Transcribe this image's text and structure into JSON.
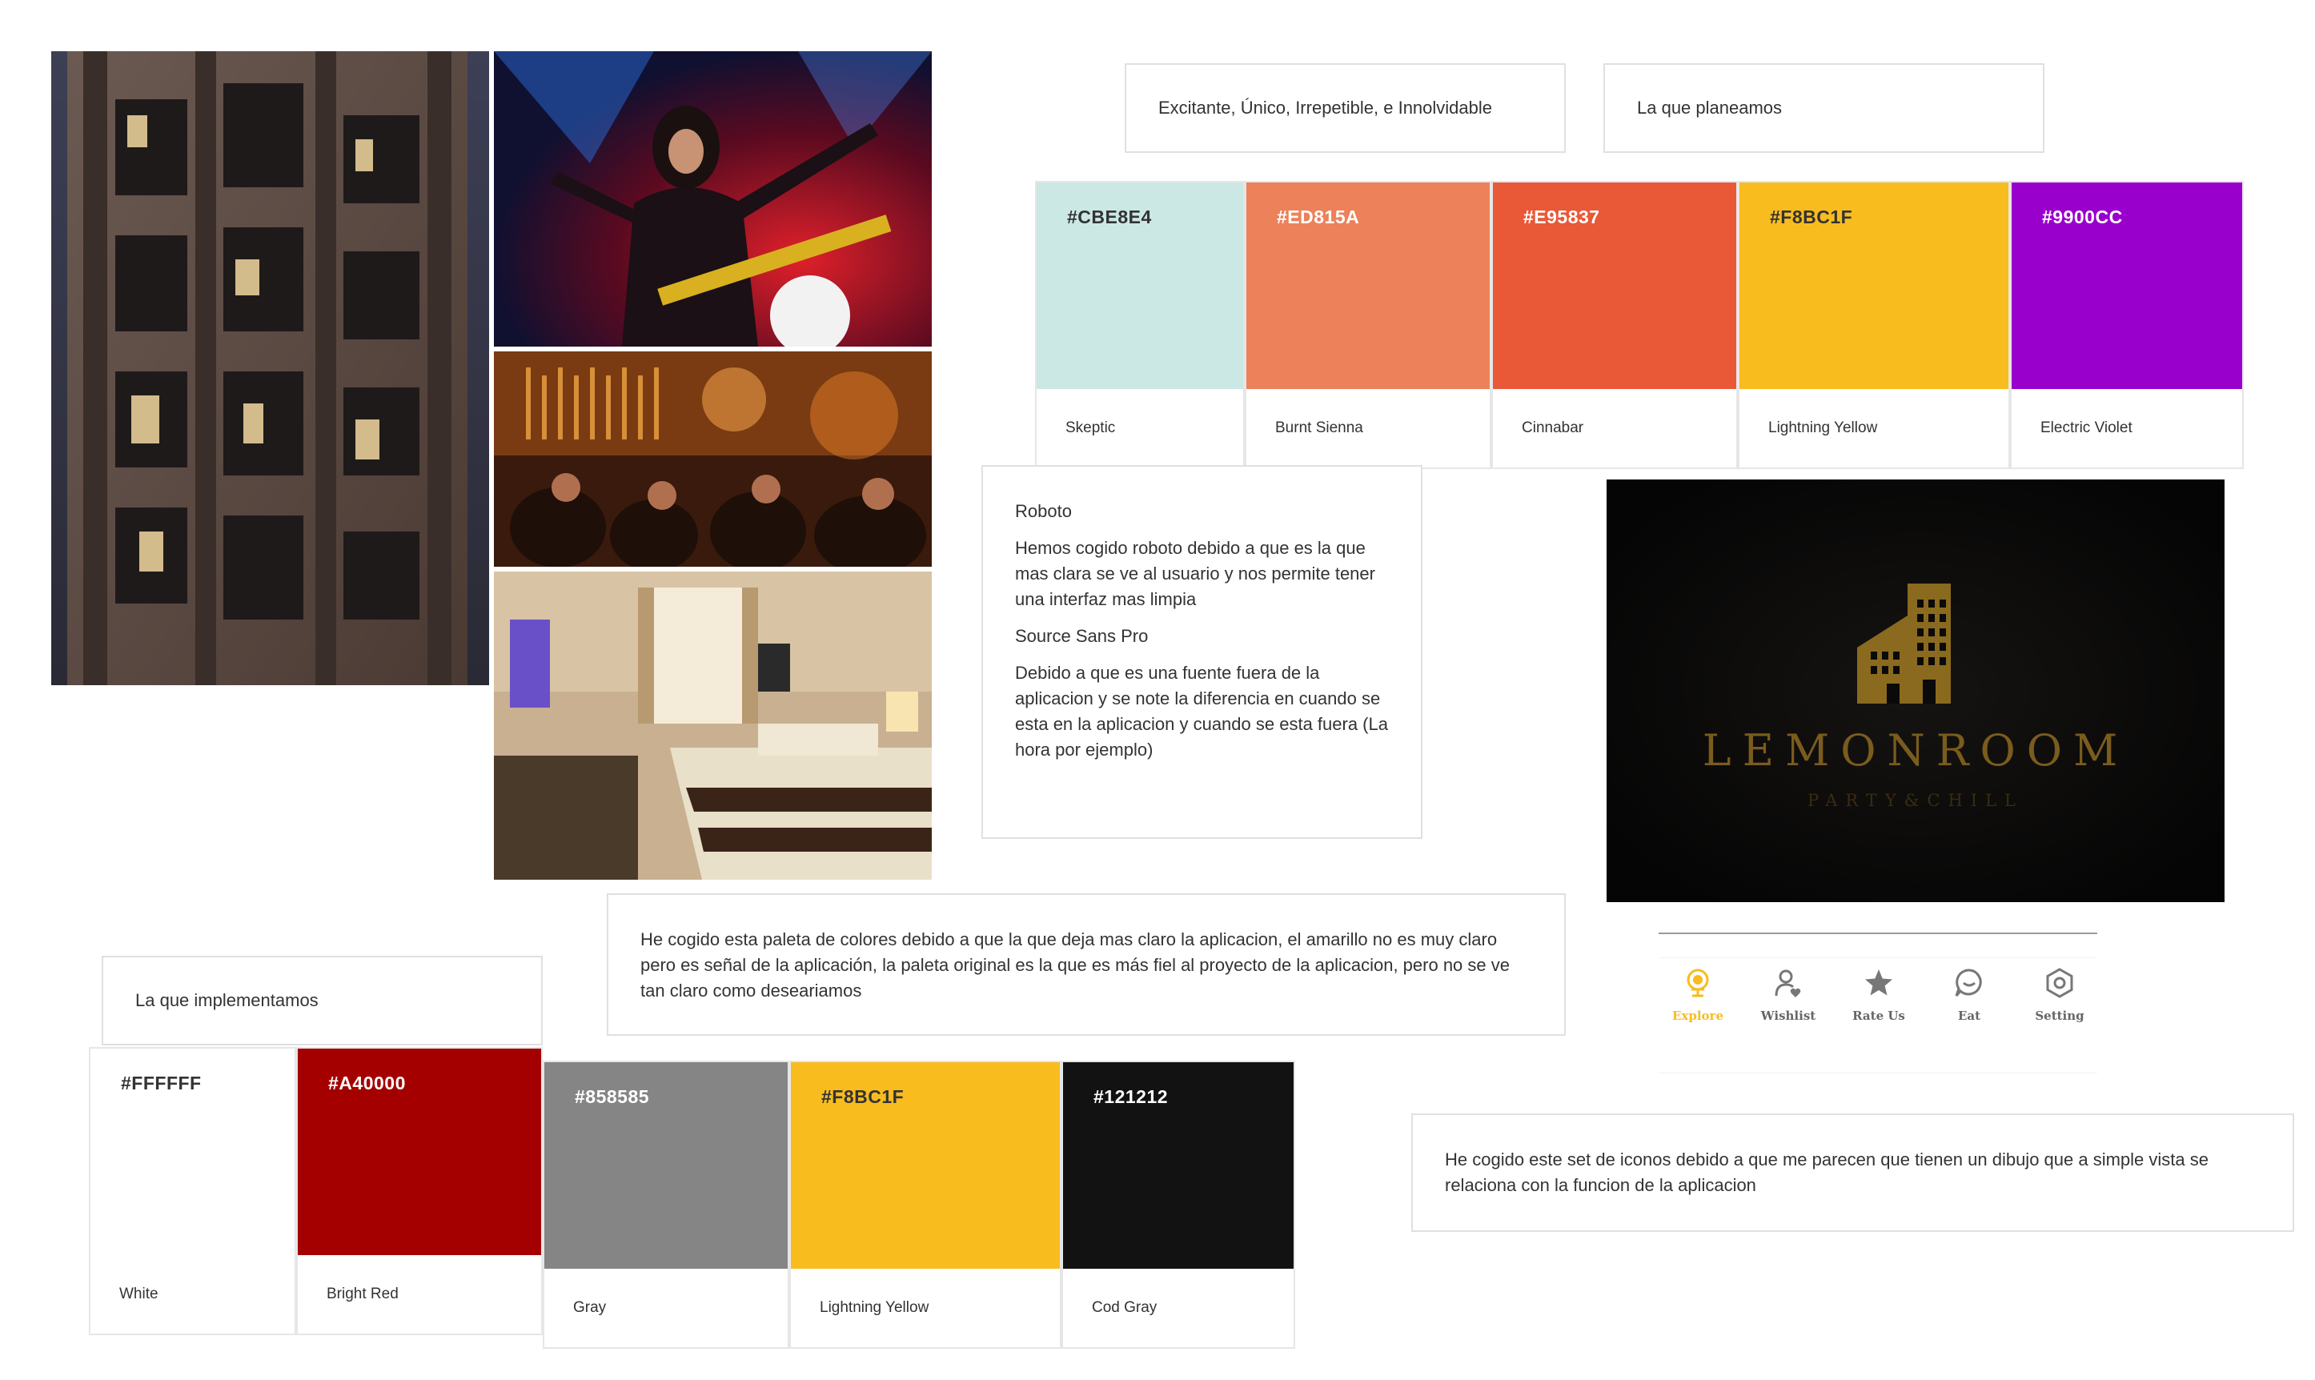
{
  "colors": {
    "page_bg": "#FFFFFF",
    "border": "#E0E0E0",
    "accent": "#F8BC1F",
    "nav_inactive": "#666666"
  },
  "photos": [
    {
      "name": "building-facade-photo",
      "subject": "hotel building facade at dusk"
    },
    {
      "name": "concert-photo",
      "subject": "rock singer with bass guitar on stage"
    },
    {
      "name": "bar-photo",
      "subject": "crowded bar with warm lighting"
    },
    {
      "name": "hotel-room-photo",
      "subject": "hotel bedroom with striped bedspread"
    }
  ],
  "boxes": {
    "planned_keywords": "Excitante, Único, Irrepetible, e Innolvidable",
    "planned_title": "La que planeamos",
    "implemented_title": "La que implementamos",
    "palette_note": "He cogido esta paleta de colores debido a que la que deja mas claro la aplicacion, el amarillo no es muy claro pero es señal de la aplicación, la paleta original es la que es más fiel al proyecto de la aplicacion, pero no se ve tan claro como deseariamos",
    "icons_note": "He cogido este set de iconos debido a que me parecen que tienen un dibujo que a simple vista se relaciona con la funcion de la aplicacion"
  },
  "fonts_card": {
    "font1_name": "Roboto",
    "font1_reason": "Hemos cogido roboto debido a que es la que mas clara se ve al usuario y nos permite tener una interfaz mas limpia",
    "font2_name": "Source Sans Pro",
    "font2_reason": "Debido a que es una fuente fuera de la aplicacion y se note la diferencia en cuando se esta en la aplicacion y cuando se esta fuera (La hora por ejemplo)"
  },
  "planned_palette": [
    {
      "hex": "#CBE8E4",
      "name": "Skeptic",
      "text_color": "#333333"
    },
    {
      "hex": "#ED815A",
      "name": "Burnt Sienna",
      "text_color": "#FFFFFF"
    },
    {
      "hex": "#E95837",
      "name": "Cinnabar",
      "text_color": "#FFFFFF"
    },
    {
      "hex": "#F8BC1F",
      "name": "Lightning Yellow",
      "text_color": "#333333"
    },
    {
      "hex": "#9900CC",
      "name": "Electric Violet",
      "text_color": "#FFFFFF"
    }
  ],
  "implemented_palette": [
    {
      "hex": "#FFFFFF",
      "name": "White",
      "text_color": "#333333"
    },
    {
      "hex": "#A40000",
      "name": "Bright Red",
      "text_color": "#FFFFFF"
    },
    {
      "hex": "#858585",
      "name": "Gray",
      "text_color": "#FFFFFF"
    },
    {
      "hex": "#F8BC1F",
      "name": "Lightning Yellow",
      "text_color": "#333333"
    },
    {
      "hex": "#121212",
      "name": "Cod Gray",
      "text_color": "#FFFFFF"
    }
  ],
  "logo": {
    "name": "LEMONROOM",
    "tagline": "PARTY&CHILL",
    "gold": "#8A6A1E",
    "bg": "#0A0A0A"
  },
  "nav": {
    "active_index": 0,
    "items": [
      {
        "label": "Explore",
        "icon": "globe-icon"
      },
      {
        "label": "Wishlist",
        "icon": "user-heart-icon"
      },
      {
        "label": "Rate Us",
        "icon": "star-icon"
      },
      {
        "label": "Eat",
        "icon": "chat-icon"
      },
      {
        "label": "Setting",
        "icon": "gear-icon"
      }
    ]
  }
}
